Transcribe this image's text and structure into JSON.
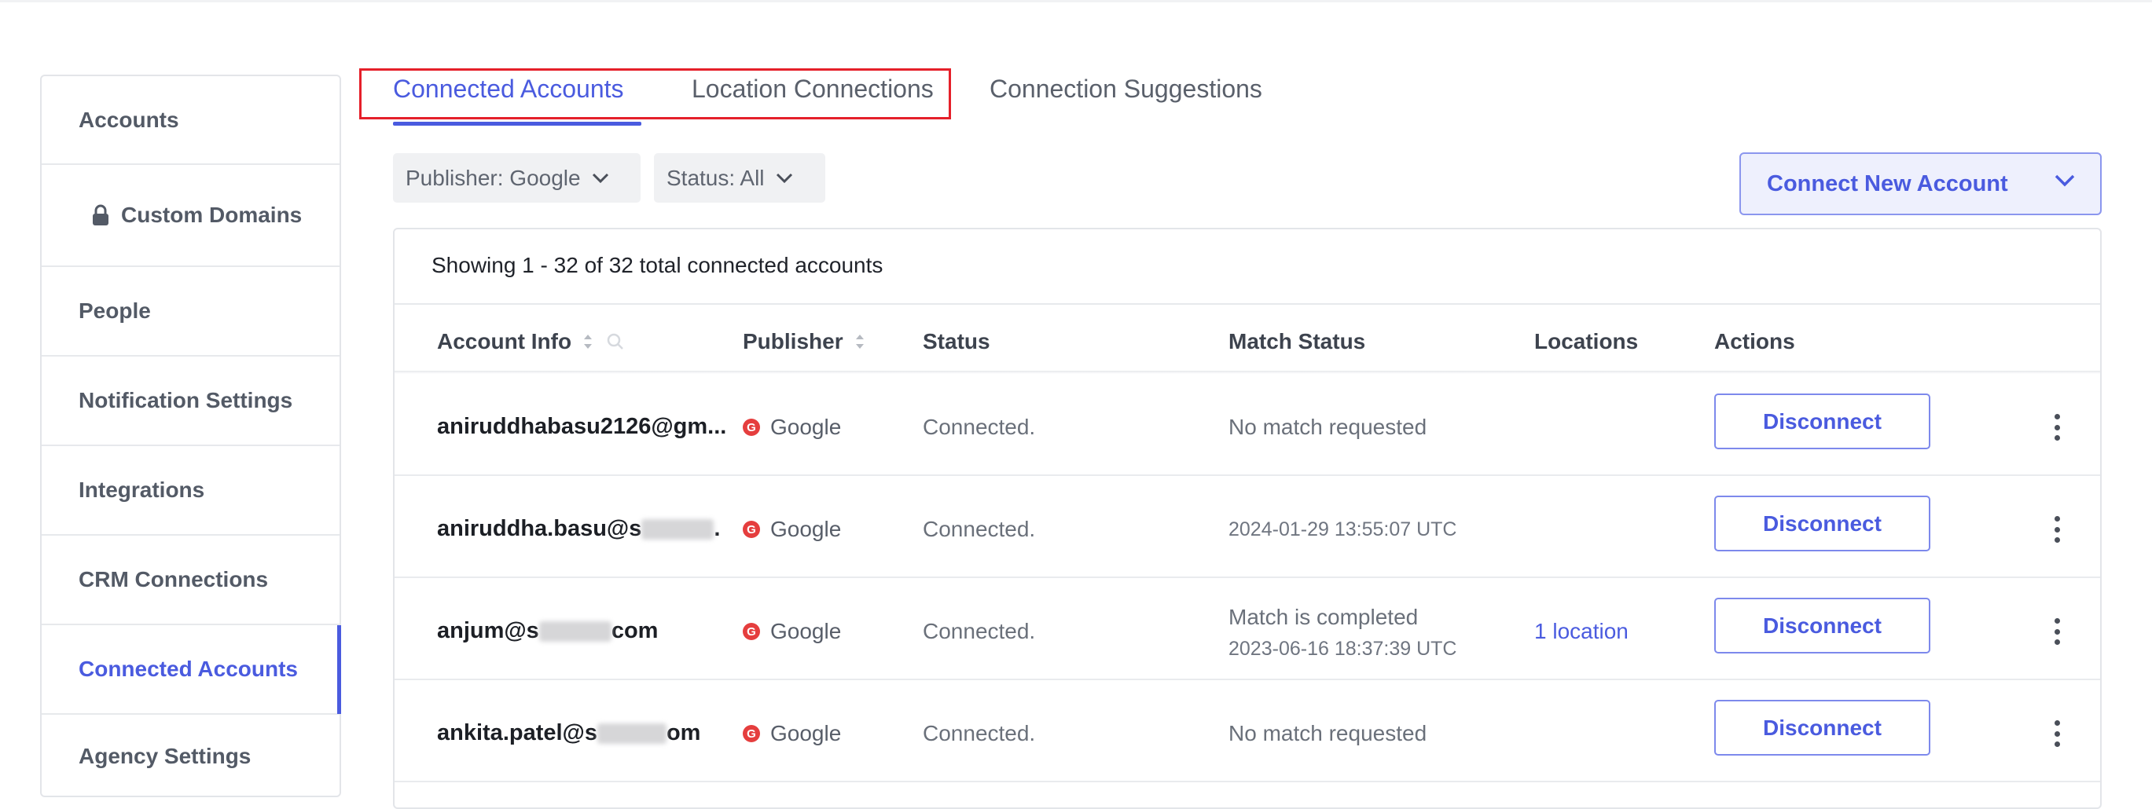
{
  "sidebar": {
    "items": [
      {
        "label": "Accounts"
      },
      {
        "label": "Custom Domains",
        "icon": "lock-icon"
      },
      {
        "label": "People"
      },
      {
        "label": "Notification Settings"
      },
      {
        "label": "Integrations"
      },
      {
        "label": "CRM Connections"
      },
      {
        "label": "Connected Accounts",
        "active": true
      },
      {
        "label": "Agency Settings"
      }
    ]
  },
  "tabs": [
    {
      "label": "Connected Accounts",
      "active": true
    },
    {
      "label": "Location Connections"
    },
    {
      "label": "Connection Suggestions"
    }
  ],
  "filters": {
    "publisher": "Publisher: Google",
    "status": "Status: All"
  },
  "connect_button": "Connect New Account",
  "table": {
    "summary": "Showing 1 - 32 of 32 total connected accounts",
    "headers": {
      "account_info": "Account Info",
      "publisher": "Publisher",
      "status": "Status",
      "match_status": "Match Status",
      "locations": "Locations",
      "actions": "Actions"
    },
    "rows": [
      {
        "account": "aniruddhabasu2126@gm...",
        "account_prefix": "",
        "account_suffix": "",
        "publisher": "Google",
        "status": "Connected.",
        "match_line1": "No match requested",
        "match_line2": "",
        "locations": "",
        "action": "Disconnect"
      },
      {
        "account": "",
        "account_prefix": "aniruddha.basu@s",
        "account_suffix": ".",
        "publisher": "Google",
        "status": "Connected.",
        "match_line1": "",
        "match_line2": "2024-01-29 13:55:07 UTC",
        "locations": "",
        "action": "Disconnect"
      },
      {
        "account": "",
        "account_prefix": "anjum@s",
        "account_suffix": "com",
        "publisher": "Google",
        "status": "Connected.",
        "match_line1": "Match is completed",
        "match_line2": "2023-06-16 18:37:39 UTC",
        "locations": "1 location",
        "action": "Disconnect"
      },
      {
        "account": "",
        "account_prefix": "ankita.patel@s",
        "account_suffix": "om",
        "publisher": "Google",
        "status": "Connected.",
        "match_line1": "No match requested",
        "match_line2": "",
        "locations": "",
        "action": "Disconnect"
      }
    ]
  },
  "colors": {
    "accent": "#4a5bdf",
    "highlight": "#e5202a",
    "google_red": "#e53e3e"
  }
}
